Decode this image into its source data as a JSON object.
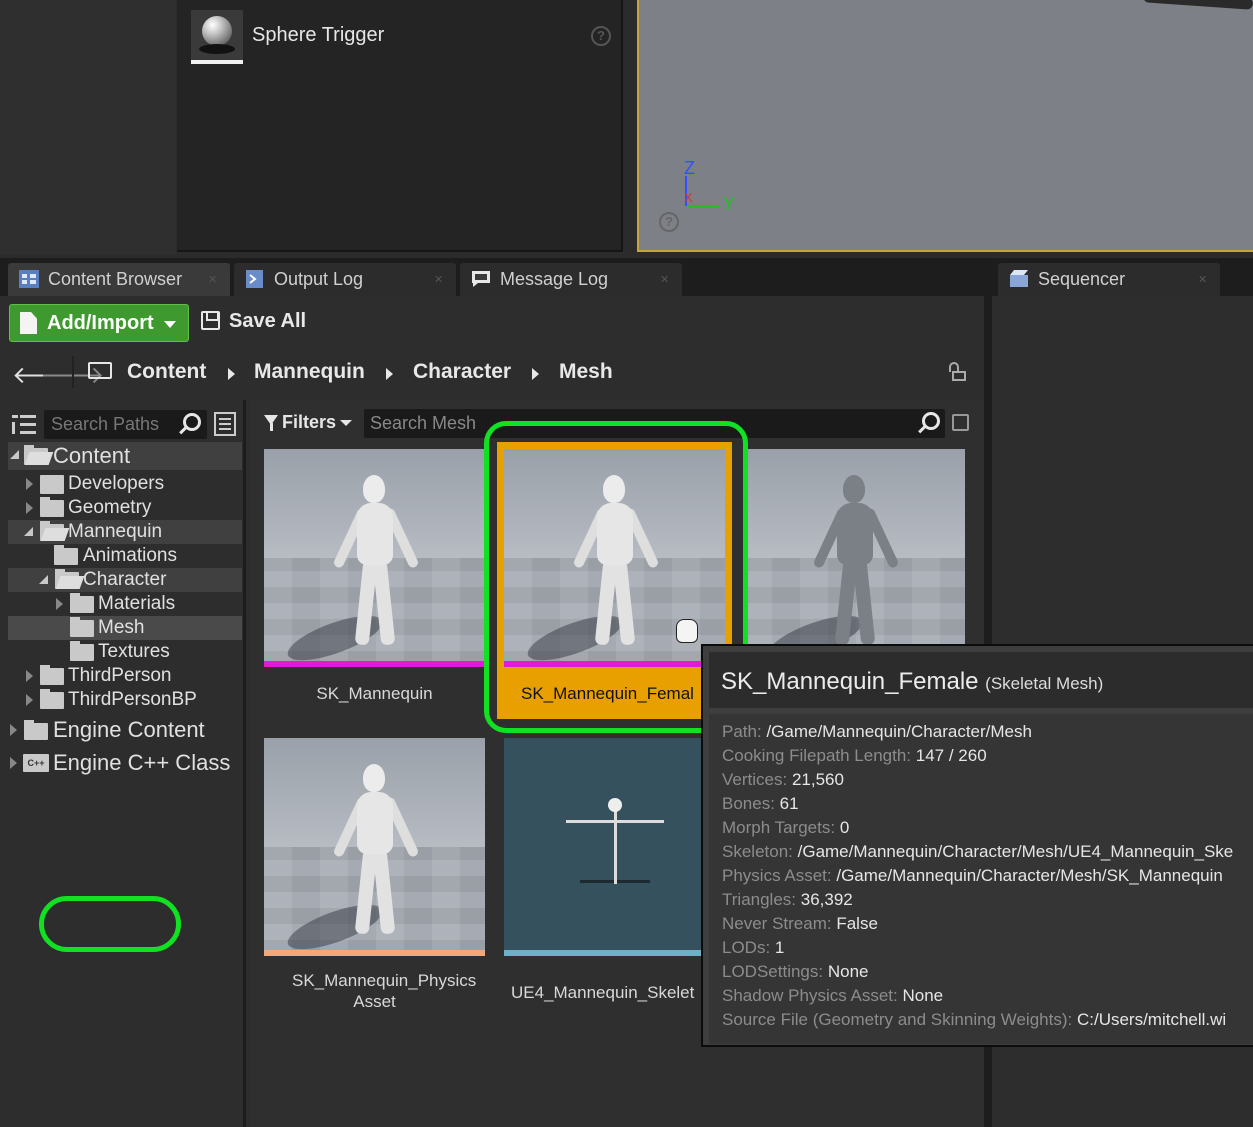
{
  "modes": {
    "item_label": "Sphere Trigger"
  },
  "viewport": {
    "axis_z": "Z",
    "axis_y": "Y",
    "axis_x": "X"
  },
  "tabs": [
    {
      "label": "Content Browser",
      "icon": "content-browser-icon"
    },
    {
      "label": "Output Log",
      "icon": "output-log-icon"
    },
    {
      "label": "Message Log",
      "icon": "message-log-icon"
    },
    {
      "label": "Sequencer",
      "icon": "sequencer-icon"
    }
  ],
  "toolbar": {
    "add_import_label": "Add/Import",
    "save_all_label": "Save All"
  },
  "breadcrumb": [
    "Content",
    "Mannequin",
    "Character",
    "Mesh"
  ],
  "sources": {
    "search_placeholder": "Search Paths",
    "tree": [
      {
        "label": "Content"
      },
      {
        "label": "Developers"
      },
      {
        "label": "Geometry"
      },
      {
        "label": "Mannequin"
      },
      {
        "label": "Animations"
      },
      {
        "label": "Character"
      },
      {
        "label": "Materials"
      },
      {
        "label": "Mesh"
      },
      {
        "label": "Textures"
      },
      {
        "label": "ThirdPerson"
      },
      {
        "label": "ThirdPersonBP"
      },
      {
        "label": "Engine Content"
      },
      {
        "label": "Engine C++ Class"
      }
    ]
  },
  "assets": {
    "filters_label": "Filters",
    "search_placeholder": "Search Mesh",
    "items": [
      {
        "name": "SK_Mannequin",
        "bar_color": "#e11ad8"
      },
      {
        "name": "SK_Mannequin_Femal",
        "bar_color": "#e11ad8"
      },
      {
        "name": "",
        "bar_color": ""
      },
      {
        "name": "SK_Mannequin_Physics Asset",
        "bar_color": "#f2a878"
      },
      {
        "name": "UE4_Mannequin_Skelet",
        "bar_color": "#6fb0c8"
      }
    ]
  },
  "tooltip": {
    "title": "SK_Mannequin_Female",
    "type": "(Skeletal Mesh)",
    "rows": [
      {
        "key": "Path:",
        "value": "/Game/Mannequin/Character/Mesh"
      },
      {
        "key": "Cooking Filepath Length:",
        "value": "147 / 260"
      },
      {
        "key": "Vertices:",
        "value": "21,560"
      },
      {
        "key": "Bones:",
        "value": "61"
      },
      {
        "key": "Morph Targets:",
        "value": "0"
      },
      {
        "key": "Skeleton:",
        "value": "/Game/Mannequin/Character/Mesh/UE4_Mannequin_Ske"
      },
      {
        "key": "Physics Asset:",
        "value": "/Game/Mannequin/Character/Mesh/SK_Mannequin"
      },
      {
        "key": "Triangles:",
        "value": "36,392"
      },
      {
        "key": "Never Stream:",
        "value": "False"
      },
      {
        "key": "LODs:",
        "value": "1"
      },
      {
        "key": "LODSettings:",
        "value": "None"
      },
      {
        "key": "Shadow Physics Asset:",
        "value": "None"
      },
      {
        "key": "Source File (Geometry and Skinning Weights):",
        "value": "C:/Users/mitchell.wi"
      }
    ]
  },
  "colors": {
    "highlight_circle": "#12e022",
    "selection": "#e8a000",
    "add_button": "#3e9a2e"
  }
}
